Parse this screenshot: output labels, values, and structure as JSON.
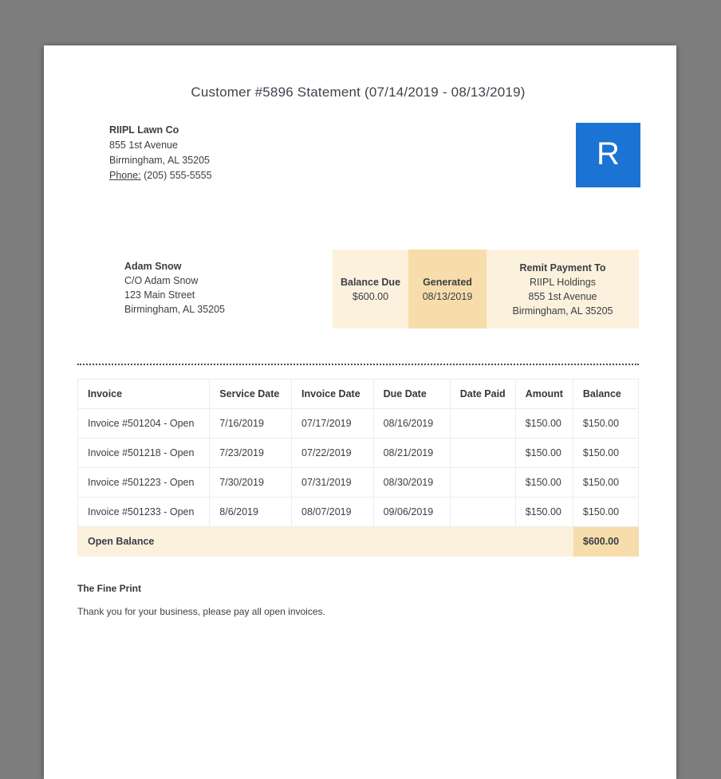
{
  "colors": {
    "bg_gray": "#7d7d7d",
    "accent_blue": "#1b74d3",
    "cream_light": "#fcf1dc",
    "cream_dark": "#f6ddab"
  },
  "page": {
    "title": "Customer #5896 Statement (07/14/2019 - 08/13/2019)"
  },
  "company": {
    "name": "RIIPL Lawn Co",
    "address_line1": "855 1st Avenue",
    "address_line2": "Birmingham, AL 35205",
    "phone_label": "Phone:",
    "phone": "(205) 555-5555",
    "logo_letter": "R"
  },
  "customer": {
    "name": "Adam Snow",
    "care_of": "C/O Adam Snow",
    "street": "123 Main Street",
    "city": "Birmingham, AL 35205"
  },
  "summary": {
    "balance_due_label": "Balance Due",
    "balance_due_value": "$600.00",
    "generated_label": "Generated",
    "generated_value": "08/13/2019",
    "remit_label": "Remit Payment To",
    "remit_name": "RIIPL Holdings",
    "remit_street": "855 1st Avenue",
    "remit_city": "Birmingham, AL 35205"
  },
  "table": {
    "headers": [
      "Invoice",
      "Service Date",
      "Invoice Date",
      "Due Date",
      "Date Paid",
      "Amount",
      "Balance"
    ],
    "rows": [
      [
        "Invoice #501204 - Open",
        "7/16/2019",
        "07/17/2019",
        "08/16/2019",
        "",
        "$150.00",
        "$150.00"
      ],
      [
        "Invoice #501218 - Open",
        "7/23/2019",
        "07/22/2019",
        "08/21/2019",
        "",
        "$150.00",
        "$150.00"
      ],
      [
        "Invoice #501223 - Open",
        "7/30/2019",
        "07/31/2019",
        "08/30/2019",
        "",
        "$150.00",
        "$150.00"
      ],
      [
        "Invoice #501233 - Open",
        "8/6/2019",
        "08/07/2019",
        "09/06/2019",
        "",
        "$150.00",
        "$150.00"
      ]
    ],
    "footer_label": "Open Balance",
    "footer_total": "$600.00"
  },
  "fine_print": {
    "heading": "The Fine Print",
    "body": "Thank you for your business, please pay all open invoices."
  }
}
